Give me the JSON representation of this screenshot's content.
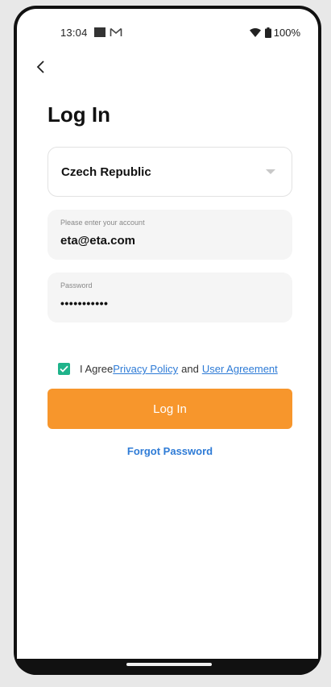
{
  "status_bar": {
    "time": "13:04",
    "battery": "100%"
  },
  "header": {
    "title": "Log In"
  },
  "form": {
    "country": "Czech Republic",
    "account_label": "Please enter your account",
    "account_value": "eta@eta.com",
    "password_label": "Password",
    "password_value": "•••••••••••"
  },
  "agreement": {
    "checked": true,
    "prefix": "I Agree",
    "privacy_link": "Privacy Policy",
    "conjunction": "and",
    "user_agreement_link": "User Agreement"
  },
  "actions": {
    "login_label": "Log In",
    "forgot_label": "Forgot Password"
  },
  "colors": {
    "accent": "#f7962c",
    "link": "#2e7bd6",
    "checkbox": "#1fb38a"
  },
  "icons": [
    "back-arrow-icon",
    "wifi-icon",
    "battery-icon",
    "gmail-icon",
    "dropdown-caret-icon",
    "checkmark-icon"
  ]
}
